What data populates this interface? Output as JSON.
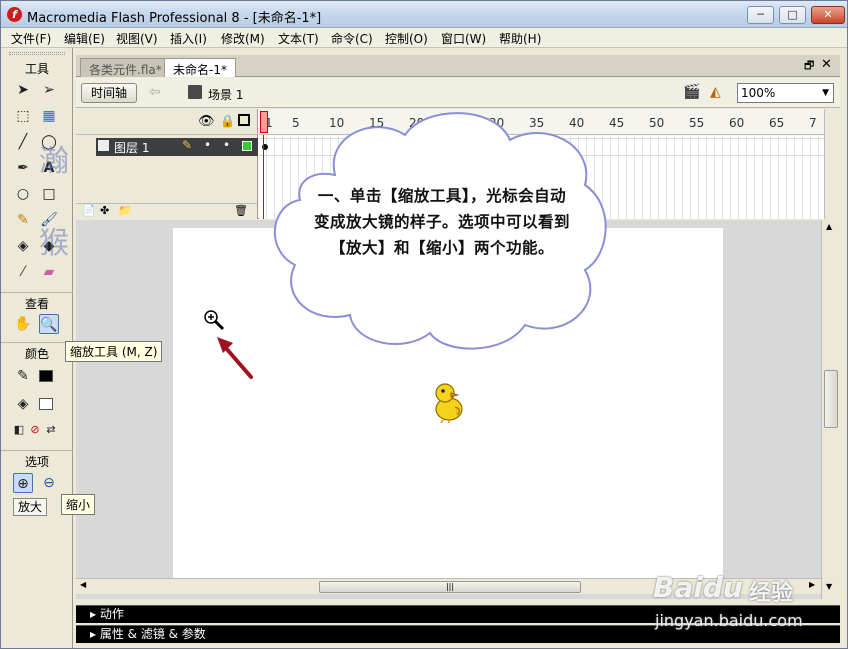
{
  "window": {
    "title": "Macromedia Flash Professional 8 - [未命名-1*]",
    "min": "─",
    "max": "□",
    "close": "✕"
  },
  "menu": [
    "文件(F)",
    "编辑(E)",
    "视图(V)",
    "插入(I)",
    "修改(M)",
    "文本(T)",
    "命令(C)",
    "控制(O)",
    "窗口(W)",
    "帮助(H)"
  ],
  "tools": {
    "header": "工具",
    "view_header": "查看",
    "color_header": "颜色",
    "options_header": "选项",
    "zoom_in_label": "放大"
  },
  "watermark": {
    "chars": [
      "瀚",
      "城",
      "猴",
      "子"
    ]
  },
  "doc": {
    "tabs": [
      "各类元件.fla*",
      "未命名-1*"
    ],
    "timeline_button": "时间轴",
    "scene": "场景 1",
    "zoom": "100%"
  },
  "timeline": {
    "layer_name": "图层 1",
    "ticks": [
      "1",
      "5",
      "10",
      "15",
      "20",
      "25",
      "30",
      "35",
      "40",
      "45",
      "50",
      "55",
      "60",
      "65",
      "7"
    ]
  },
  "panels": {
    "actions": "▸ 动作",
    "properties": "▸ 属性 & 滤镜 & 参数"
  },
  "tooltips": {
    "zoom_tool": "缩放工具 (M, Z)",
    "zoom_out": "缩小"
  },
  "callout": {
    "text": "一、单击【缩放工具】，光标会自动变成放大镜的样子。选项中可以看到【放大】和【缩小】两个功能。"
  },
  "baidu": {
    "logo": "Baidu",
    "text": "经验",
    "url": "jingyan.baidu.com"
  },
  "colors": {
    "stroke": "#000000",
    "fill": "#ff0000",
    "callout_border": "#8a8fd6",
    "arrow": "#a01020"
  }
}
